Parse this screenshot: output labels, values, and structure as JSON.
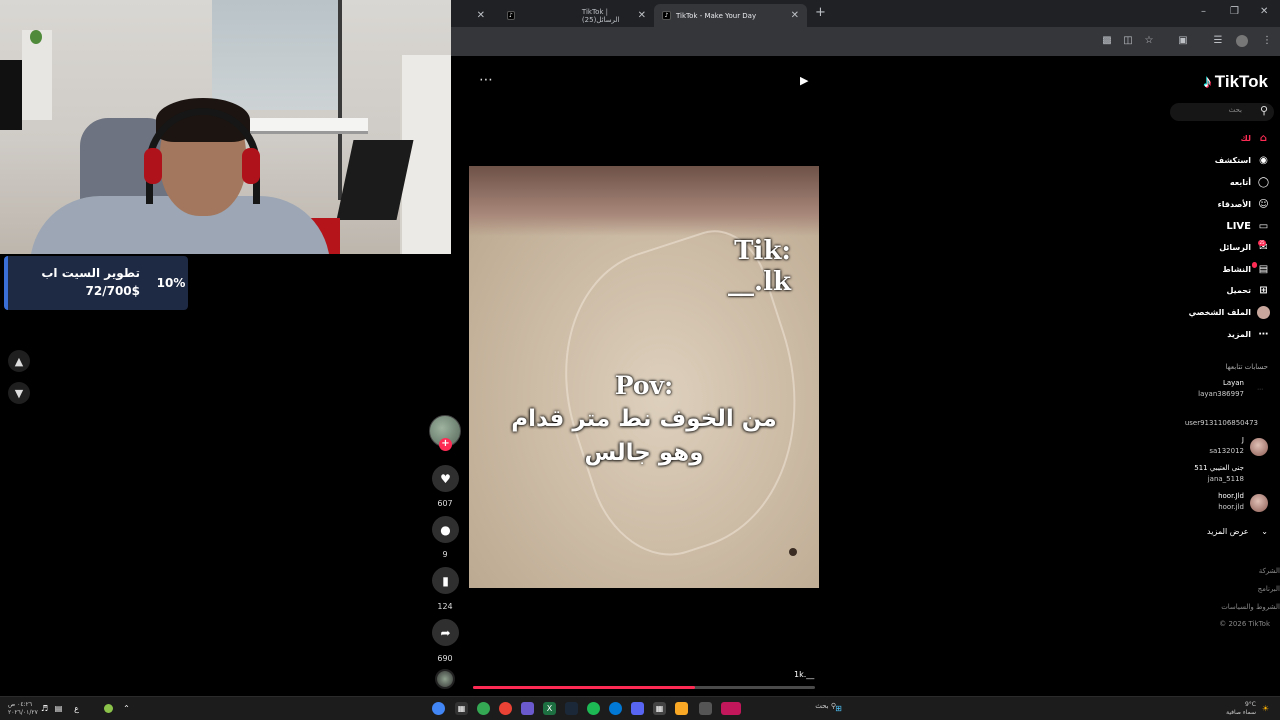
{
  "stream": {
    "goal_percent": "10%",
    "goal_title": "تطوير السيت اب",
    "goal_amount": "72/700$"
  },
  "browser": {
    "tabs": [
      {
        "label": "TikTok | الرسائل(25)",
        "active": false
      },
      {
        "label": "TikTok - Make Your Day",
        "active": true
      }
    ],
    "new_tab": "+"
  },
  "video": {
    "caption_tik": "Tik:",
    "caption_handle": "__.lk",
    "caption_pov": "Pov:",
    "caption_line1": "من الخوف نط متر قدام",
    "caption_line2": "وهو جالس",
    "author": "1k.__",
    "progress": 0.65
  },
  "actions": {
    "likes": "607",
    "comments": "9",
    "saves": "124",
    "shares": "690"
  },
  "sidebar": {
    "logo": "TikTok",
    "search_placeholder": "بحث",
    "nav": [
      {
        "label": "لك",
        "icon": "home-icon",
        "active": true
      },
      {
        "label": "استكشف",
        "icon": "compass-icon",
        "active": false
      },
      {
        "label": "أتابعه",
        "icon": "following-icon",
        "active": false
      },
      {
        "label": "الأصدقاء",
        "icon": "friends-icon",
        "active": false
      },
      {
        "label": "LIVE",
        "icon": "live-icon",
        "active": false
      },
      {
        "label": "الرسائل",
        "icon": "messages-icon",
        "active": false,
        "badge": "25"
      },
      {
        "label": "النشاط",
        "icon": "activity-icon",
        "active": false
      },
      {
        "label": "تحميل",
        "icon": "upload-icon",
        "active": false
      },
      {
        "label": "الملف الشخصي",
        "icon": "profile-icon",
        "active": false
      },
      {
        "label": "المزيد",
        "icon": "more-icon",
        "active": false
      }
    ],
    "following_title": "حسابات تتابعها",
    "accounts": [
      {
        "name": "Layan",
        "user": "layan386997"
      },
      {
        "name": "",
        "user": "user9131106850473"
      },
      {
        "name": "J",
        "user": "sa132012"
      },
      {
        "name": "جنى العتيبي 511",
        "user": "jana_5118"
      },
      {
        "name": "hoor.Jld",
        "user": "hoor.jld"
      }
    ],
    "see_more": "عرض المزيد",
    "footer": [
      "الشركة",
      "البرنامج",
      "الشروط والسياسات",
      "© 2026 TikTok"
    ]
  },
  "taskbar": {
    "search": "بحث",
    "weather": "9°C",
    "weather_desc": "سماء صافية",
    "time": "٠٤:٢٦ ص",
    "date": "٢٠٢٦/٠١/٢٧"
  }
}
